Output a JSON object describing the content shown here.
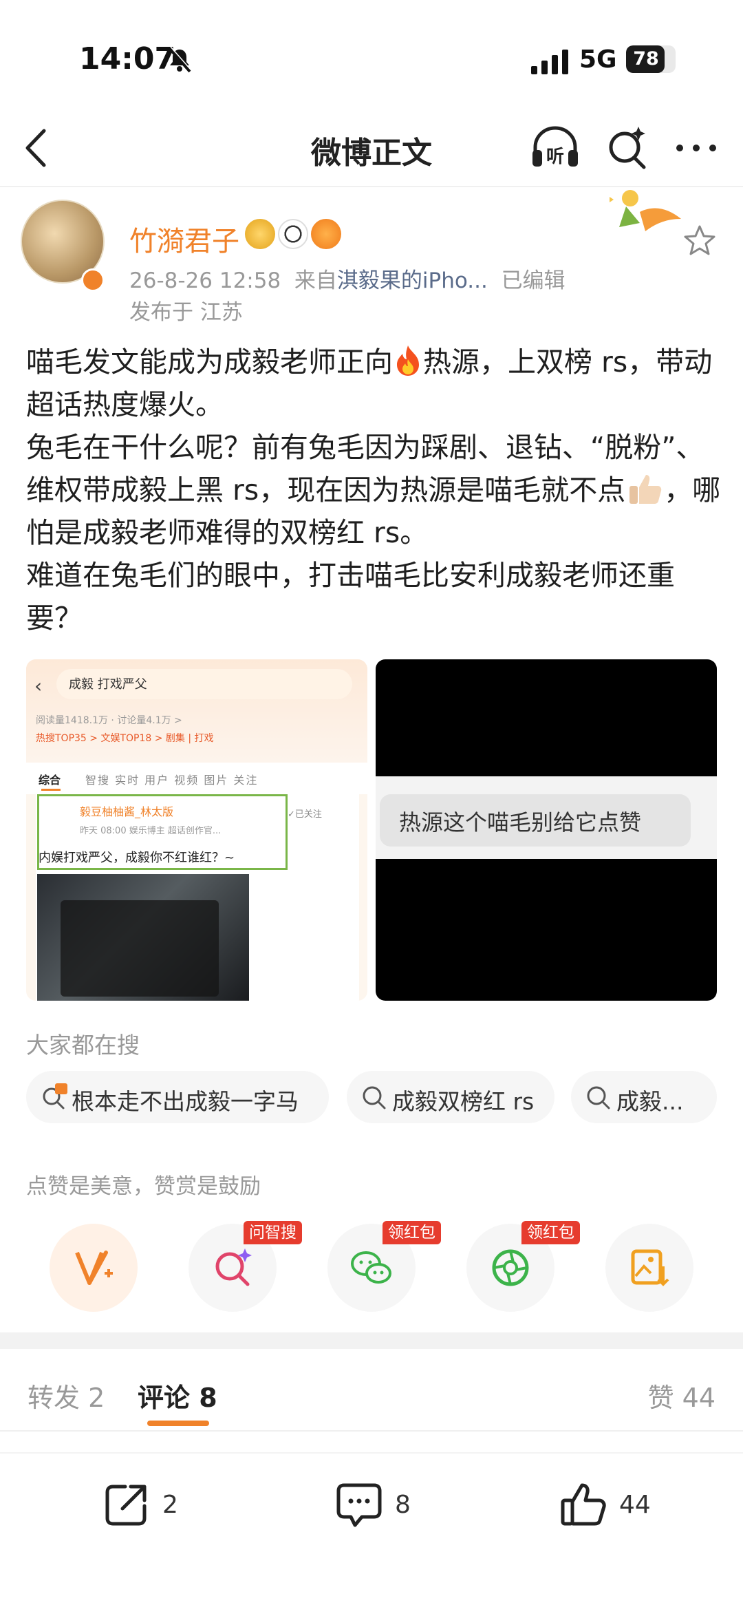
{
  "status_bar": {
    "time": "14:07",
    "network": "5G",
    "battery": "78",
    "battery_level": 0.78
  },
  "nav": {
    "title": "微博正文"
  },
  "post": {
    "author": "竹漪君子",
    "timestamp": "26-8-26 12:58",
    "source_prefix": "来自",
    "source": "淇毅果的iPho...",
    "edited": "已编辑",
    "location": "发布于 江苏",
    "body": {
      "line1_a": "喵毛发文能成为成毅老师正向",
      "line1_b": "热源，上双榜 rs，带动超话热度爆火。",
      "line2": "兔毛在干什么呢？前有兔毛因为踩剧、退钻、“脱粉”、维权带成毅上黑 rs，现在因为热源是喵毛就不点",
      "line3": "，哪怕是成毅老师难得的双榜红 rs。",
      "line4": "难道在兔毛们的眼中，打击喵毛比安利成毅老师还重要？"
    }
  },
  "images": {
    "left": {
      "query": "成毅 打戏严父",
      "stats": "阅读量1418.1万 · 讨论量4.1万 >",
      "tags": "热搜TOP35 >   文娱TOP18 >   剧集 | 打戏",
      "tab_active": "综合",
      "tabs_rest": "智搜  实时  用户  视频  图片  关注",
      "author": "毅豆柚柚酱_林太版",
      "author_sub": "昨天 08:00  娱乐博主 超话创作官...",
      "follow": "✓已关注",
      "headline": "内娱打戏严父，成毅你不红谁红？~"
    },
    "right": {
      "overlay_text": "热源这个喵毛别给它点赞"
    }
  },
  "trending": {
    "heading": "大家都在搜",
    "chips": [
      "根本走不出成毅一字马",
      "成毅双榜红 rs",
      "成毅..."
    ]
  },
  "reward": {
    "heading": "点赞是美意，赞赏是鼓励",
    "tags": [
      "问智搜",
      "领红包",
      "领红包"
    ]
  },
  "tabs": {
    "repost": "转发 2",
    "comment": "评论 8",
    "likes": "赞 44"
  },
  "actions": {
    "share_count": "2",
    "comment_count": "8",
    "like_count": "44"
  },
  "colors": {
    "accent": "#f0822a",
    "tag_red": "#e63c2e",
    "muted": "#999999"
  }
}
